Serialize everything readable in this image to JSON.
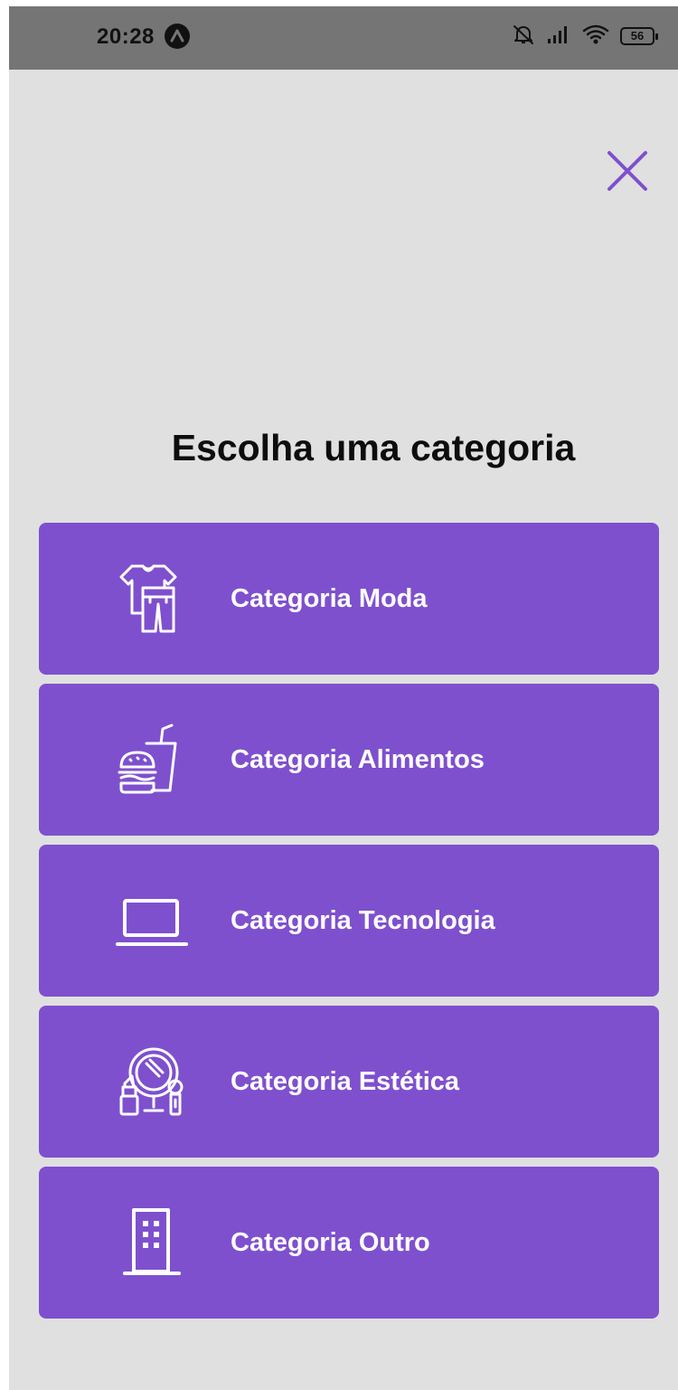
{
  "status_bar": {
    "time": "20:28",
    "battery": "56",
    "icons": [
      "arch-icon",
      "bell-off-icon",
      "signal-icon",
      "wifi-icon",
      "battery-icon"
    ]
  },
  "modal": {
    "title": "Escolha uma categoria",
    "close_icon": "close-icon",
    "accent_color": "#7e50ce",
    "background_color": "#e0e0e0"
  },
  "categories": [
    {
      "label": "Categoria Moda",
      "icon": "clothes-icon"
    },
    {
      "label": "Categoria Alimentos",
      "icon": "food-icon"
    },
    {
      "label": "Categoria Tecnologia",
      "icon": "laptop-icon"
    },
    {
      "label": "Categoria Estética",
      "icon": "beauty-icon"
    },
    {
      "label": "Categoria Outro",
      "icon": "building-icon"
    }
  ]
}
